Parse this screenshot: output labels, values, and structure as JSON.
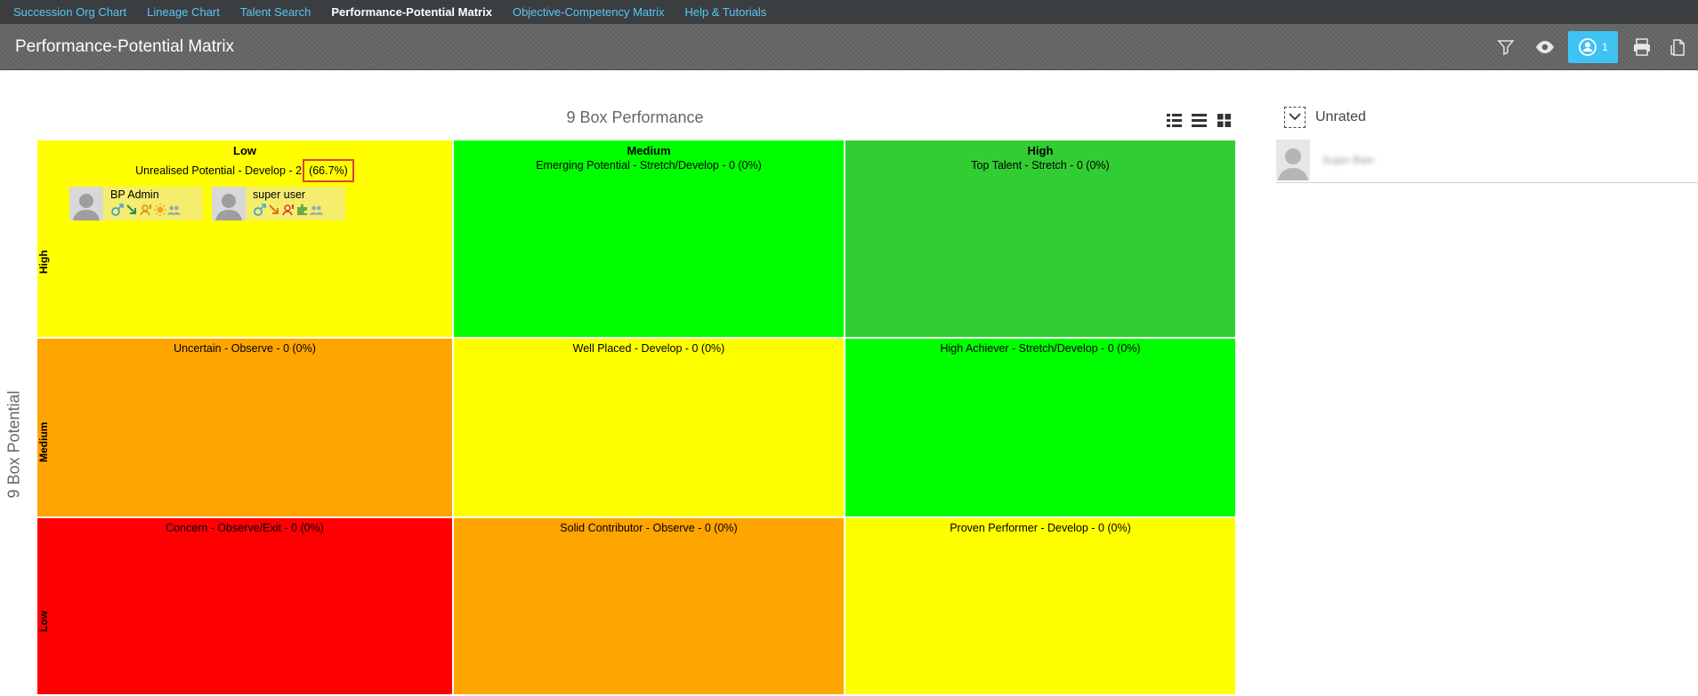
{
  "nav": {
    "items": [
      {
        "label": "Succession Org Chart",
        "active": false
      },
      {
        "label": "Lineage Chart",
        "active": false
      },
      {
        "label": "Talent Search",
        "active": false
      },
      {
        "label": "Performance-Potential Matrix",
        "active": true
      },
      {
        "label": "Objective-Competency Matrix",
        "active": false
      },
      {
        "label": "Help & Tutorials",
        "active": false
      }
    ]
  },
  "header": {
    "title": "Performance-Potential Matrix",
    "tools": [
      {
        "icon": "filter-icon"
      },
      {
        "icon": "eye-icon"
      },
      {
        "icon": "assignment-icon",
        "count": "1"
      },
      {
        "icon": "print-icon"
      },
      {
        "icon": "export-icon"
      }
    ]
  },
  "matrix": {
    "title": "9 Box Performance",
    "y_axis_title": "9 Box Potential",
    "columns": [
      "Low",
      "Medium",
      "High"
    ],
    "rows": [
      "High",
      "Medium",
      "Low"
    ],
    "cells": [
      {
        "label": "Unrealised Potential - Develop - 2",
        "pct": "(66.7%)",
        "color": "#ffff00"
      },
      {
        "label": "Emerging Potential - Stretch/Develop - 0 (0%)",
        "color": "#00ff00"
      },
      {
        "label": "Top Talent - Stretch - 0 (0%)",
        "color": "#32cd32"
      },
      {
        "label": "Uncertain - Observe - 0 (0%)",
        "color": "#ffa500"
      },
      {
        "label": "Well Placed - Develop - 0 (0%)",
        "color": "#ffff00"
      },
      {
        "label": "High Achiever - Stretch/Develop - 0 (0%)",
        "color": "#00ff00"
      },
      {
        "label": "Concern - Observe/Exit - 0 (0%)",
        "color": "#ff0000"
      },
      {
        "label": "Solid Contributor - Observe - 0 (0%)",
        "color": "#ffa500"
      },
      {
        "label": "Proven Performer - Develop - 0 (0%)",
        "color": "#ffff00"
      }
    ],
    "people": [
      {
        "name": "BP Admin",
        "icons": [
          "gender-icon",
          "arrow-down-right-icon",
          "person-alert-icon",
          "sun-icon",
          "group-icon"
        ]
      },
      {
        "name": "super user",
        "icons": [
          "gender-icon",
          "arrow-down-right-icon",
          "person-alert-icon",
          "puzzle-icon",
          "group-icon"
        ]
      }
    ]
  },
  "unrated": {
    "label": "Unrated",
    "items": [
      {
        "name": "Sujan Bain"
      }
    ]
  }
}
